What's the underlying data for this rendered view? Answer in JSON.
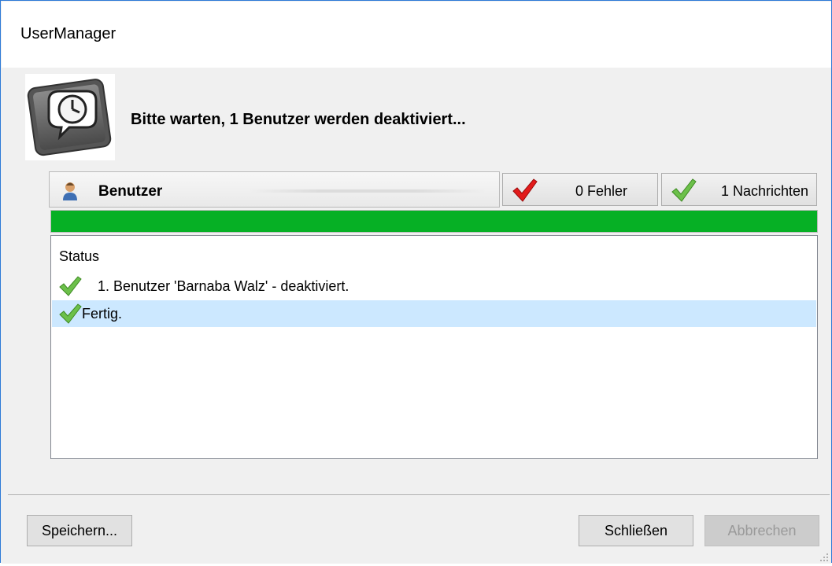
{
  "window": {
    "title": "UserManager"
  },
  "dialog": {
    "icon": "clock-speech-bubble-icon",
    "message": "Bitte warten, 1 Benutzer werden deaktiviert..."
  },
  "header": {
    "user_label": "Benutzer",
    "user_icon": "user-icon",
    "errors_label": "0 Fehler",
    "errors_icon": "red-check-icon",
    "messages_label": "1 Nachrichten",
    "messages_icon": "green-check-icon"
  },
  "progress": {
    "fraction": 1.0
  },
  "status_list": {
    "header": "Status",
    "items": [
      {
        "text": "1. Benutzer 'Barnaba Walz' - deaktiviert.",
        "icon": "green-check-icon",
        "selected": false
      },
      {
        "text": "Fertig.",
        "icon": "green-check-icon",
        "selected": true
      }
    ]
  },
  "buttons": {
    "save_label": "Speichern...",
    "close_label": "Schließen",
    "cancel_label": "Abbrechen",
    "cancel_enabled": false
  },
  "colors": {
    "progress": "#06b025",
    "selection": "#cce8ff",
    "accent_border": "#2b79d6"
  }
}
